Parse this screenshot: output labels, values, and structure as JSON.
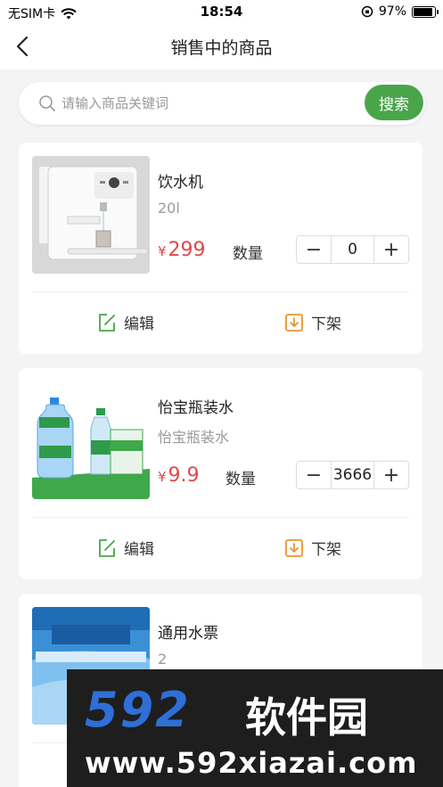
{
  "status_bar": {
    "carrier": "无SIM卡",
    "time": "18:54",
    "battery": "97%",
    "battery_level": 0.97
  },
  "nav": {
    "title": "销售中的商品",
    "back_icon": "chevron-left-icon"
  },
  "search": {
    "placeholder": "请输入商品关键词",
    "button_label": "搜索",
    "accent": "#4aa54a"
  },
  "products": [
    {
      "name": "饮水机",
      "spec": "20l",
      "currency": "¥",
      "price": "299",
      "qty_label": "数量",
      "qty": "0",
      "edit_label": "编辑",
      "offshelf_label": "下架",
      "image": "water-dispenser"
    },
    {
      "name": "怡宝瓶装水",
      "spec": "怡宝瓶装水",
      "currency": "¥",
      "price": "9.9",
      "qty_label": "数量",
      "qty": "3666",
      "edit_label": "编辑",
      "offshelf_label": "下架",
      "image": "bottled-water"
    },
    {
      "name": "通用水票",
      "spec": "2",
      "image": "water-ticket"
    }
  ],
  "colors": {
    "price": "#e04848",
    "edit_icon": "#4aa54a",
    "offshelf_icon": "#e8952e"
  },
  "watermark": {
    "logo": "592",
    "name": "软件园",
    "url": "www.592xiazai.com"
  }
}
